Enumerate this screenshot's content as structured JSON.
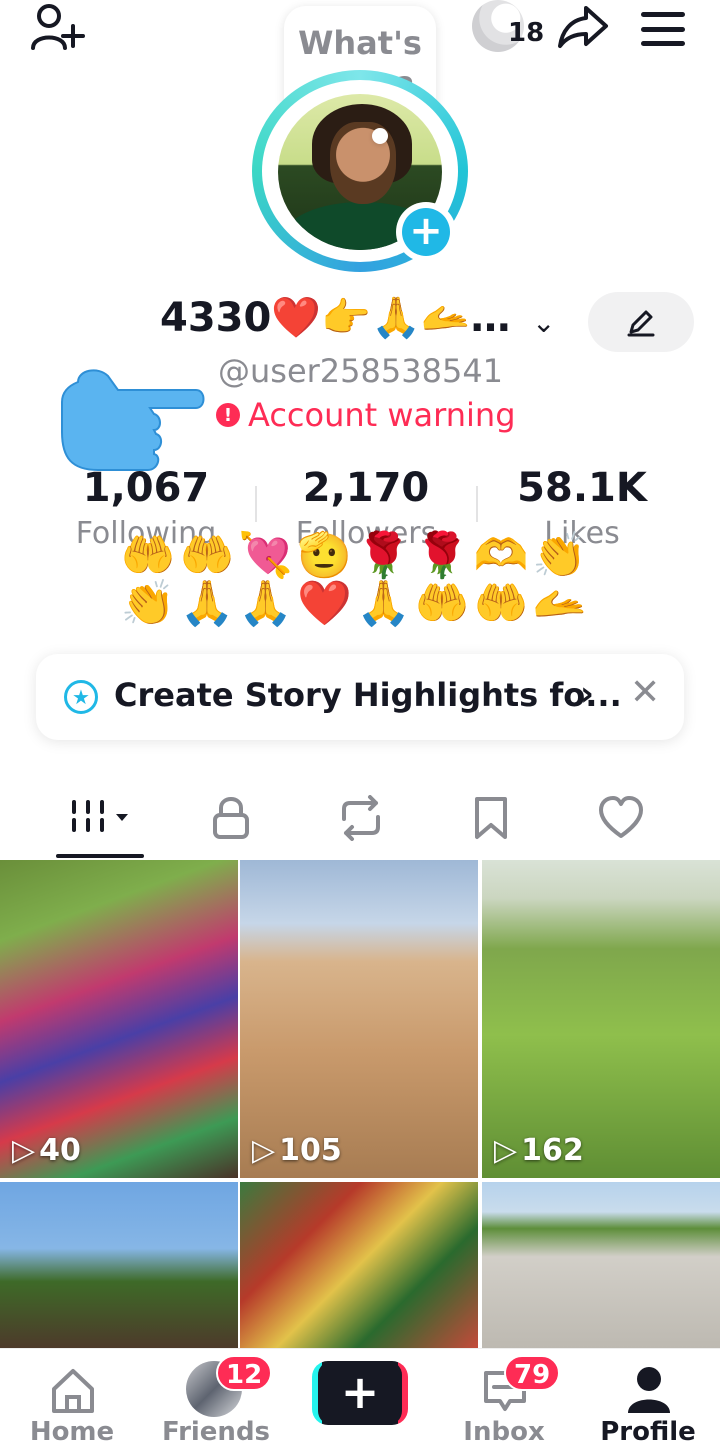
{
  "header": {
    "visits_count": "18",
    "status_bubble": [
      "What's",
      "good?"
    ]
  },
  "profile": {
    "display_name": "4330❤️👉🙏🫴…",
    "username": "@user258538541",
    "warning": "Account warning",
    "bio_emojis": "🤲🤲💘🫡🌹🌹🫶👏👏🙏🙏❤️🙏🤲🤲🫴"
  },
  "stats": [
    {
      "value": "1,067",
      "label": "Following"
    },
    {
      "value": "2,170",
      "label": "Followers"
    },
    {
      "value": "58.1K",
      "label": "Likes"
    }
  ],
  "highlights_banner": {
    "text": "Create Story Highlights fo..."
  },
  "tabs": [
    "videos-grid-icon",
    "lock-icon",
    "repost-icon",
    "bookmark-icon",
    "heart-icon"
  ],
  "videos": [
    {
      "views": "40"
    },
    {
      "views": "105"
    },
    {
      "views": "162"
    },
    {
      "views": ""
    },
    {
      "views": ""
    },
    {
      "views": ""
    }
  ],
  "bottom_nav": {
    "home": "Home",
    "friends": "Friends",
    "friends_badge": "12",
    "inbox": "Inbox",
    "inbox_badge": "79",
    "profile": "Profile"
  },
  "colors": {
    "accent": "#fe2c55",
    "cyan": "#25f4ee",
    "text_primary": "#161823",
    "text_secondary": "#8a8b91"
  }
}
